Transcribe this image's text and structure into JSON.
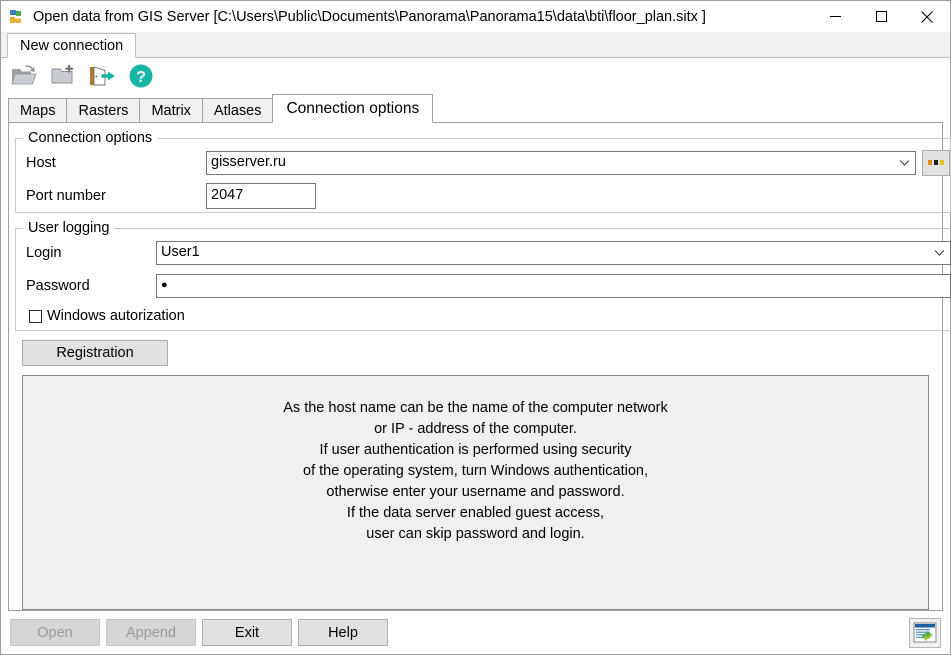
{
  "window": {
    "title": "Open data from GIS Server [C:\\Users\\Public\\Documents\\Panorama\\Panorama15\\data\\bti\\floor_plan.sitx ]",
    "icon": "gis-server-folder-icon",
    "minimize_label": "—",
    "maximize_label": "□",
    "close_label": "✕"
  },
  "document_tabs": [
    {
      "label": "New connection",
      "active": true
    }
  ],
  "toolbar": {
    "buttons": [
      {
        "name": "open-folder-icon",
        "tooltip": "Open"
      },
      {
        "name": "new-folder-icon",
        "tooltip": "New"
      },
      {
        "name": "exit-door-icon",
        "tooltip": "Exit"
      },
      {
        "name": "help-question-icon",
        "tooltip": "Help"
      }
    ]
  },
  "tabs": [
    {
      "label": "Maps",
      "active": false
    },
    {
      "label": "Rasters",
      "active": false
    },
    {
      "label": "Matrix",
      "active": false
    },
    {
      "label": "Atlases",
      "active": false
    },
    {
      "label": "Connection options",
      "active": true
    }
  ],
  "connection_options": {
    "legend": "Connection options",
    "host": {
      "label": "Host",
      "value": "gisserver.ru",
      "placeholder": "",
      "browse_label": "..."
    },
    "port": {
      "label": "Port number",
      "value": "2047",
      "placeholder": ""
    }
  },
  "user_logging": {
    "legend": "User logging",
    "login": {
      "label": "Login",
      "value": "User1",
      "placeholder": ""
    },
    "password": {
      "label": "Password",
      "value": "●",
      "placeholder": ""
    },
    "windows_auth": {
      "label": "Windows autorization",
      "checked": false
    }
  },
  "registration": {
    "label": "Registration"
  },
  "info": {
    "lines": [
      "As the host name can be the name of the computer network",
      "or IP - address of the computer.",
      "If user authentication is performed using security",
      "of the operating system, turn Windows authentication,",
      "otherwise enter your username and password.",
      "If the data server enabled guest access,",
      "user can skip password and login."
    ],
    "line1": "As the host name can be the name of the computer network",
    "line2": "or IP - address of the computer.",
    "line3": "If user authentication is performed using security",
    "line4": "of the operating system, turn Windows authentication,",
    "line5": "otherwise enter your username and password.",
    "line6": "If the data server enabled guest access,",
    "line7": "user can skip password and login."
  },
  "footer": {
    "open_label": "Open",
    "open_enabled": false,
    "append_label": "Append",
    "append_enabled": false,
    "exit_label": "Exit",
    "help_label": "Help",
    "status_icon": "window-refresh-icon"
  },
  "colors": {
    "accent_teal": "#15b6a6",
    "door_brown": "#b4762f",
    "dialog_face": "#f0f0f0",
    "button_face": "#e1e1e1",
    "field_border": "#767676",
    "group_border": "#c8c8c8",
    "disabled_text": "#9a9a9a"
  }
}
